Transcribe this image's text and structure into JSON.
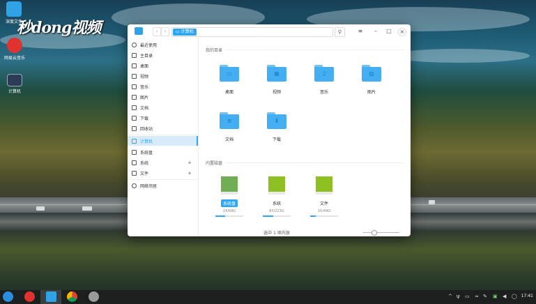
{
  "desktop": {
    "icons": [
      {
        "label": "深度文件",
        "icon": "folder-icon"
      },
      {
        "label": "网易云音乐",
        "icon": "netease-music-icon"
      },
      {
        "label": "计算机",
        "icon": "computer-icon"
      }
    ],
    "watermark": "秒dong视频"
  },
  "window": {
    "breadcrumb": "计算机",
    "sidebar": {
      "items": [
        {
          "label": "最近使用",
          "icon": "clock-icon"
        },
        {
          "label": "主目录",
          "icon": "home-icon"
        },
        {
          "label": "桌面",
          "icon": "desktop-icon"
        },
        {
          "label": "视频",
          "icon": "video-icon"
        },
        {
          "label": "音乐",
          "icon": "music-icon"
        },
        {
          "label": "图片",
          "icon": "picture-icon"
        },
        {
          "label": "文档",
          "icon": "document-icon"
        },
        {
          "label": "下载",
          "icon": "download-icon"
        },
        {
          "label": "回收站",
          "icon": "trash-icon"
        },
        {
          "label": "计算机",
          "icon": "computer-icon",
          "active": true
        },
        {
          "label": "系统盘",
          "icon": "disk-icon"
        },
        {
          "label": "系统",
          "icon": "disk-icon",
          "eject": true
        },
        {
          "label": "文件",
          "icon": "disk-icon",
          "eject": true
        },
        {
          "label": "网络邻居",
          "icon": "network-icon"
        }
      ]
    },
    "sections": {
      "my_dirs": "我的目录",
      "builtin_disks": "内置磁盘"
    },
    "folders": [
      {
        "label": "桌面",
        "icon": "desktop-folder-icon"
      },
      {
        "label": "视频",
        "icon": "video-folder-icon"
      },
      {
        "label": "音乐",
        "icon": "music-folder-icon"
      },
      {
        "label": "图片",
        "icon": "picture-folder-icon"
      },
      {
        "label": "文档",
        "icon": "document-folder-icon"
      },
      {
        "label": "下载",
        "icon": "download-folder-icon"
      }
    ],
    "disks": [
      {
        "label": "系统盘",
        "size": "24/68G",
        "usage": 0.35,
        "selected": true
      },
      {
        "label": "系统",
        "size": "83/223G",
        "usage": 0.37
      },
      {
        "label": "文件",
        "size": "10/49G",
        "usage": 0.2
      }
    ],
    "status": "选中 1 项内容",
    "zoom_level": 0.3
  },
  "taskbar": {
    "clock": "17:41"
  }
}
